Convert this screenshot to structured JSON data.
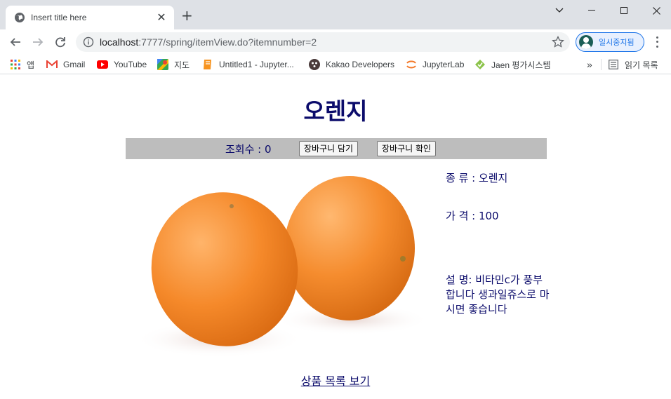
{
  "browser": {
    "tab_title": "Insert title here",
    "url_host": "localhost",
    "url_path": ":7777/spring/itemView.do?itemnumber=2",
    "profile_label": "일시중지됨",
    "bookmarks": [
      {
        "label": "앱",
        "icon": "apps-grid-icon"
      },
      {
        "label": "Gmail",
        "icon": "gmail-icon"
      },
      {
        "label": "YouTube",
        "icon": "youtube-icon"
      },
      {
        "label": "지도",
        "icon": "maps-icon"
      },
      {
        "label": "Untitled1 - Jupyter...",
        "icon": "notebook-icon"
      },
      {
        "label": "Kakao Developers",
        "icon": "kakao-icon"
      },
      {
        "label": "JupyterLab",
        "icon": "jupyter-icon"
      },
      {
        "label": "Jaen 평가시스템",
        "icon": "jaen-icon"
      }
    ],
    "reading_list": "읽기 목록",
    "more": "»"
  },
  "page": {
    "title": "오렌지",
    "views": "조회수 : 0",
    "cart_add": "장바구니 담기",
    "cart_view": "장바구니 확인",
    "kind": "종 류 : 오렌지",
    "price": "가 격 : 100",
    "description": "설 명: 비타민c가 풍부합니다 생과일쥬스로 마시면 좋습니다",
    "list_link": "상품 목록 보기"
  }
}
